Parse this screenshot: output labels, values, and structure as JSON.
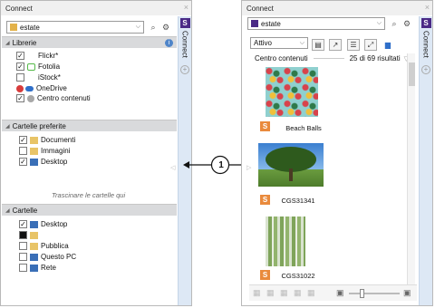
{
  "left": {
    "title": "Connect",
    "close": "×",
    "search_value": "estate",
    "sidetab_label": "Connect",
    "sidetab_badge": "S",
    "libraries": {
      "header": "Librerie",
      "items": [
        {
          "label": "Flickr*",
          "checked": true
        },
        {
          "label": "Fotolia",
          "checked": true
        },
        {
          "label": "iStock*",
          "checked": false
        },
        {
          "label": "OneDrive",
          "checked": false
        },
        {
          "label": "Centro contenuti",
          "checked": true
        }
      ]
    },
    "favorites": {
      "header": "Cartelle preferite",
      "items": [
        {
          "label": "Documenti",
          "checked": true
        },
        {
          "label": "Immagini",
          "checked": false
        },
        {
          "label": "Desktop",
          "checked": true
        }
      ],
      "drag_hint": "Trascinare le cartelle qui"
    },
    "folders": {
      "header": "Cartelle",
      "items": [
        {
          "label": "Desktop",
          "checked": true
        },
        {
          "label": "",
          "checked": false
        },
        {
          "label": "Pubblica",
          "checked": false
        },
        {
          "label": "Questo PC",
          "checked": false
        },
        {
          "label": "Rete",
          "checked": false
        }
      ]
    }
  },
  "callout": "1",
  "right": {
    "title": "Connect",
    "close": "×",
    "search_value": "estate",
    "sidetab_label": "Connect",
    "sidetab_badge": "S",
    "filter_value": "Attivo",
    "source_label": "Centro contenuti",
    "result_count": "25 di 69 risultati",
    "items": [
      {
        "caption": "Beach Balls",
        "badge": "S"
      },
      {
        "caption": "CGS31341",
        "badge": "S"
      },
      {
        "caption": "CGS31022",
        "badge": "S"
      }
    ]
  }
}
